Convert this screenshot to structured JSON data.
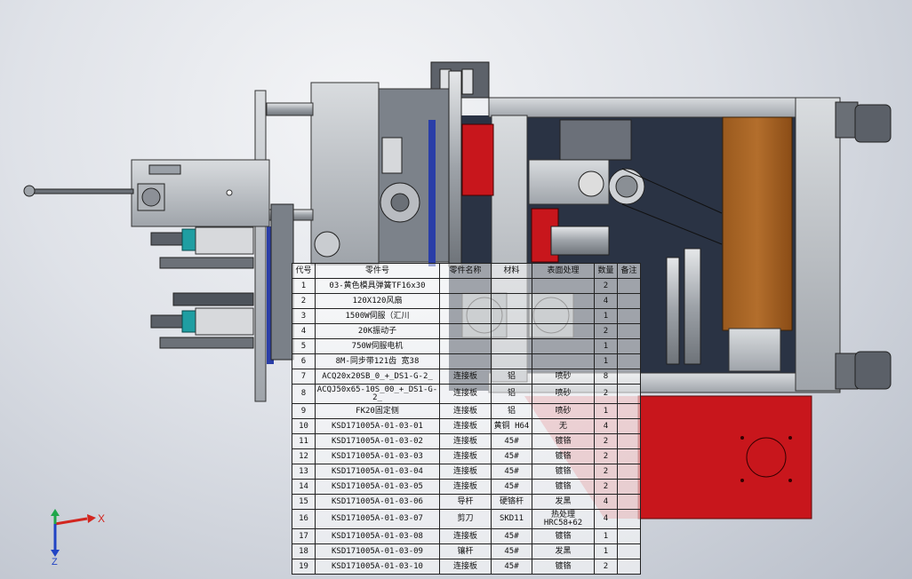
{
  "viewport": {
    "background_top": "#f4f5f7",
    "background_bottom": "#b8bec9"
  },
  "triad": {
    "x_label": "X",
    "y_label": "Y",
    "z_label": "Z",
    "x_color": "#d2261f",
    "y_color": "#1fa64a",
    "z_color": "#2144c4"
  },
  "bom": {
    "headers": [
      "代号",
      "零件号",
      "零件名称",
      "材料",
      "表面处理",
      "数量",
      "备注"
    ],
    "rows": [
      [
        "1",
        "03-黄色模具弹簧TF16x30",
        "",
        "",
        "",
        "2",
        ""
      ],
      [
        "2",
        "120X120风扇",
        "",
        "",
        "",
        "4",
        ""
      ],
      [
        "3",
        "1500W伺服（汇川",
        "",
        "",
        "",
        "1",
        ""
      ],
      [
        "4",
        "20K振动子",
        "",
        "",
        "",
        "2",
        ""
      ],
      [
        "5",
        "750W伺服电机",
        "",
        "",
        "",
        "1",
        ""
      ],
      [
        "6",
        "8M-同步带121齿 宽38",
        "",
        "",
        "",
        "1",
        ""
      ],
      [
        "7",
        "ACQ20x20SB_0_+_DS1-G-2_",
        "连接板",
        "铝",
        "喷砂",
        "8",
        ""
      ],
      [
        "8",
        "ACQJ50x65-10S_00_+_DS1-G-2_",
        "连接板",
        "铝",
        "喷砂",
        "2",
        ""
      ],
      [
        "9",
        "FK20固定侧",
        "连接板",
        "铝",
        "喷砂",
        "1",
        ""
      ],
      [
        "10",
        "KSD171005A-01-03-01",
        "连接板",
        "黄铜 H64",
        "无",
        "4",
        ""
      ],
      [
        "11",
        "KSD171005A-01-03-02",
        "连接板",
        "45#",
        "镀铬",
        "2",
        ""
      ],
      [
        "12",
        "KSD171005A-01-03-03",
        "连接板",
        "45#",
        "镀铬",
        "2",
        ""
      ],
      [
        "13",
        "KSD171005A-01-03-04",
        "连接板",
        "45#",
        "镀铬",
        "2",
        ""
      ],
      [
        "14",
        "KSD171005A-01-03-05",
        "连接板",
        "45#",
        "镀铬",
        "2",
        ""
      ],
      [
        "15",
        "KSD171005A-01-03-06",
        "导杆",
        "硬铬杆",
        "发黑",
        "4",
        ""
      ],
      [
        "16",
        "KSD171005A-01-03-07",
        "剪刀",
        "SKD11",
        "热处理HRC58+62",
        "4",
        ""
      ],
      [
        "17",
        "KSD171005A-01-03-08",
        "连接板",
        "45#",
        "镀铬",
        "1",
        ""
      ],
      [
        "18",
        "KSD171005A-01-03-09",
        "镶杆",
        "45#",
        "发黑",
        "1",
        ""
      ],
      [
        "19",
        "KSD171005A-01-03-10",
        "连接板",
        "45#",
        "镀铬",
        "2",
        ""
      ]
    ]
  }
}
